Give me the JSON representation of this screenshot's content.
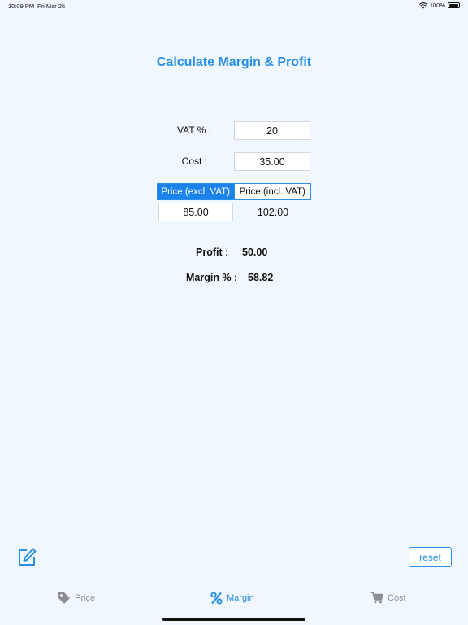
{
  "status": {
    "time": "10:09 PM",
    "date": "Fri Mar 26",
    "battery": "100%"
  },
  "title": "Calculate Margin & Profit",
  "form": {
    "vat_label": "VAT % :",
    "vat_value": "20",
    "cost_label": "Cost :",
    "cost_value": "35.00"
  },
  "price_mode": {
    "options": [
      "Price (excl. VAT)",
      "Price (incl. VAT)"
    ],
    "selected": "Price (excl. VAT)",
    "excl_value": "85.00",
    "incl_value": "102.00"
  },
  "results": {
    "profit_label": "Profit :",
    "profit_value": "50.00",
    "margin_label": "Margin % :",
    "margin_value": "58.82"
  },
  "actions": {
    "reset_label": "reset"
  },
  "tabs": [
    {
      "label": "Price",
      "icon": "tag-icon"
    },
    {
      "label": "Margin",
      "icon": "percent-icon"
    },
    {
      "label": "Cost",
      "icon": "cart-icon"
    }
  ],
  "colors": {
    "accent": "#2a8fe6",
    "background": "#f0f7fe",
    "inactive_tab": "#8b8f94"
  }
}
